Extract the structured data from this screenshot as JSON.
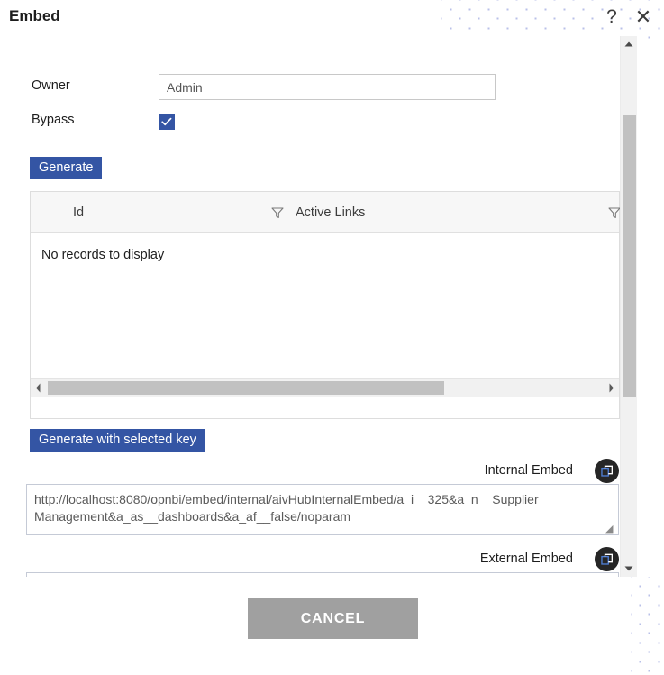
{
  "dialog": {
    "title": "Embed",
    "help_icon": "?",
    "close_icon": "✕"
  },
  "form": {
    "owner_label": "Owner",
    "owner_value": "Admin",
    "owner_placeholder": "Owner",
    "bypass_label": "Bypass",
    "bypass_checked": true
  },
  "actions": {
    "generate_label": "Generate",
    "generate_with_key_label": "Generate with selected key",
    "cancel_label": "CANCEL"
  },
  "grid": {
    "columns": [
      {
        "label": "Id",
        "filter_icon": "filter-icon"
      },
      {
        "label": "Active Links",
        "filter_icon": "filter-icon"
      }
    ],
    "rows": [],
    "empty_message": "No records to display",
    "hscroll": {
      "left_arrow": "◀",
      "right_arrow": "▶"
    }
  },
  "internal_embed": {
    "caption": "Internal Embed",
    "copy_icon": "copy-icon",
    "value": "http://localhost:8080/opnbi/embed/internal/aivHubInternalEmbed/a_i__325&a_n__Supplier Management&a_as__dashboards&a_af__false/noparam",
    "placeholder": ""
  },
  "external_embed": {
    "caption": "External Embed",
    "copy_icon": "copy-icon",
    "value": "",
    "placeholder": ""
  },
  "scrollbar": {
    "up_arrow": "▲",
    "down_arrow": "▼"
  },
  "colors": {
    "primary": "#3455a4",
    "cancel": "#a0a0a0",
    "dots": "#b9c0e8",
    "scroll_thumb": "#c1c1c1"
  }
}
